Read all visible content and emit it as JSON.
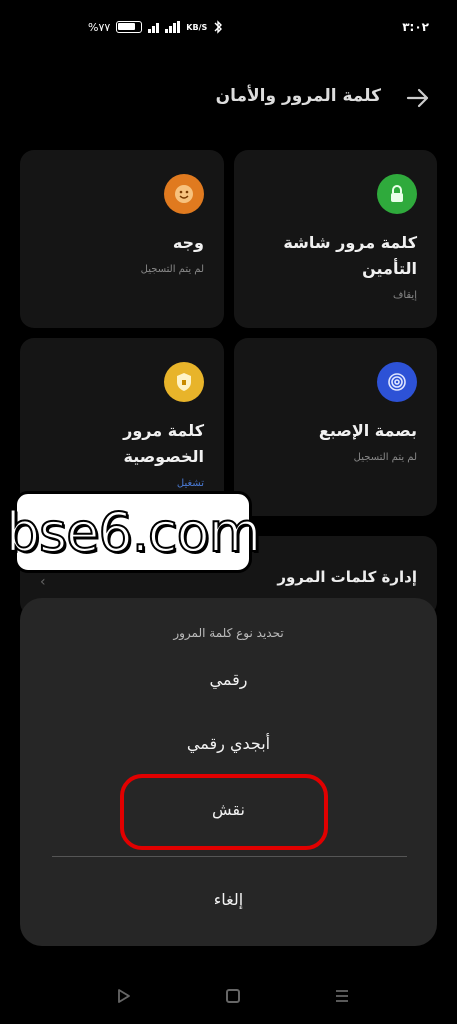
{
  "status_bar": {
    "time": "٣:٠٢",
    "battery": "%٧٧",
    "speed_unit": "KB/S"
  },
  "header": {
    "title": "كلمة المرور والأمان",
    "back_icon": "arrow-right-icon"
  },
  "cards": {
    "face": {
      "title": "وجه",
      "subtitle": "لم يتم التسجيل",
      "icon": "face-icon",
      "icon_color": "#e07a1f"
    },
    "lock_password": {
      "title_line1": "كلمة مرور شاشة",
      "title_line2": "التأمين",
      "subtitle": "إيقاف",
      "icon": "lock-icon",
      "icon_color": "#2faa3c"
    },
    "privacy_password": {
      "title_line1": "كلمة مرور",
      "title_line2": "الخصوصية",
      "subtitle": "تشغيل",
      "icon": "shield-icon",
      "icon_color": "#e8b42a"
    },
    "fingerprint": {
      "title": "بصمة الإصبع",
      "subtitle": "لم يتم التسجيل",
      "icon": "fingerprint-icon",
      "icon_color": "#2d52d6"
    }
  },
  "manage_passwords": {
    "label": "إدارة كلمات المرور"
  },
  "watermark": {
    "text": "bse6.com"
  },
  "sheet": {
    "title": "تحديد نوع كلمة المرور",
    "options": [
      "رقمي",
      "أبجدي رقمي",
      "نقش"
    ],
    "cancel": "إلغاء",
    "highlight_color": "#e10000"
  },
  "nav_bar": {
    "icons": [
      "back-triangle-icon",
      "home-square-icon",
      "recents-menu-icon"
    ]
  }
}
